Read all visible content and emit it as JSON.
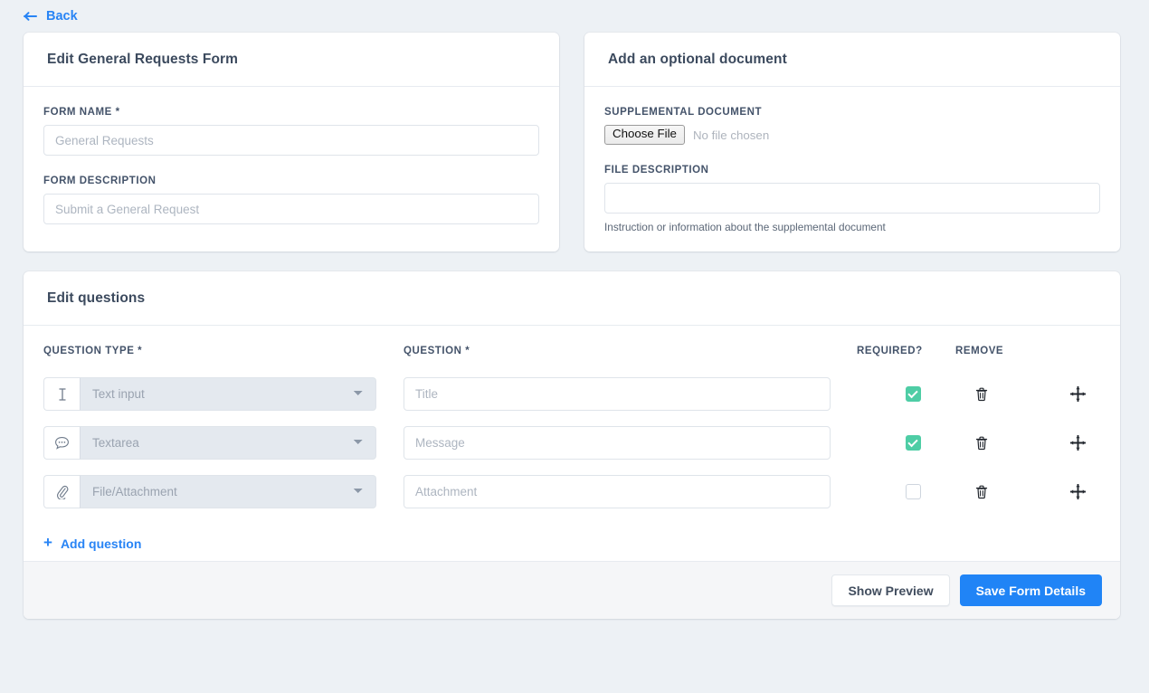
{
  "back": {
    "label": "Back",
    "icon": "arrow-left-icon",
    "color": "#2884f5"
  },
  "theme": {
    "page_bg": "#edf1f5",
    "accent_blue": "#2084f6",
    "accent_green": "#4ecda5",
    "text_dark": "#3c4a5e"
  },
  "form_card": {
    "title": "Edit General Requests Form",
    "fields": {
      "form_name_label": "FORM NAME *",
      "form_name_value": "",
      "form_name_placeholder": "General Requests",
      "form_description_label": "FORM DESCRIPTION",
      "form_description_value": "",
      "form_description_placeholder": "Submit a General Request"
    }
  },
  "document_card": {
    "title": "Add an optional document",
    "supplemental_label": "SUPPLEMENTAL DOCUMENT",
    "choose_file_label": "Choose File",
    "no_file_text": "No file chosen",
    "file_description_label": "FILE DESCRIPTION",
    "file_description_value": "",
    "file_description_placeholder": "",
    "help_text": "Instruction or information about the supplemental document"
  },
  "questions_card": {
    "title": "Edit questions",
    "headers": {
      "type": "QUESTION TYPE *",
      "question": "QUESTION *",
      "required": "REQUIRED?",
      "remove": "REMOVE"
    },
    "rows": [
      {
        "icon": "text-cursor-icon",
        "type_value": "Text input",
        "type_options": [
          "Text input",
          "Textarea",
          "File/Attachment"
        ],
        "question_value": "",
        "question_placeholder": "Title",
        "required": true
      },
      {
        "icon": "speech-bubble-icon",
        "type_value": "Textarea",
        "type_options": [
          "Text input",
          "Textarea",
          "File/Attachment"
        ],
        "question_value": "",
        "question_placeholder": "Message",
        "required": true
      },
      {
        "icon": "paperclip-icon",
        "type_value": "File/Attachment",
        "type_options": [
          "Text input",
          "Textarea",
          "File/Attachment"
        ],
        "question_value": "",
        "question_placeholder": "Attachment",
        "required": false
      }
    ],
    "add_question_label": "Add question",
    "add_question_icon": "plus-icon",
    "remove_icon": "trash-icon",
    "drag_icon": "move-arrows-icon"
  },
  "footer": {
    "show_preview_label": "Show Preview",
    "save_label": "Save Form Details"
  }
}
